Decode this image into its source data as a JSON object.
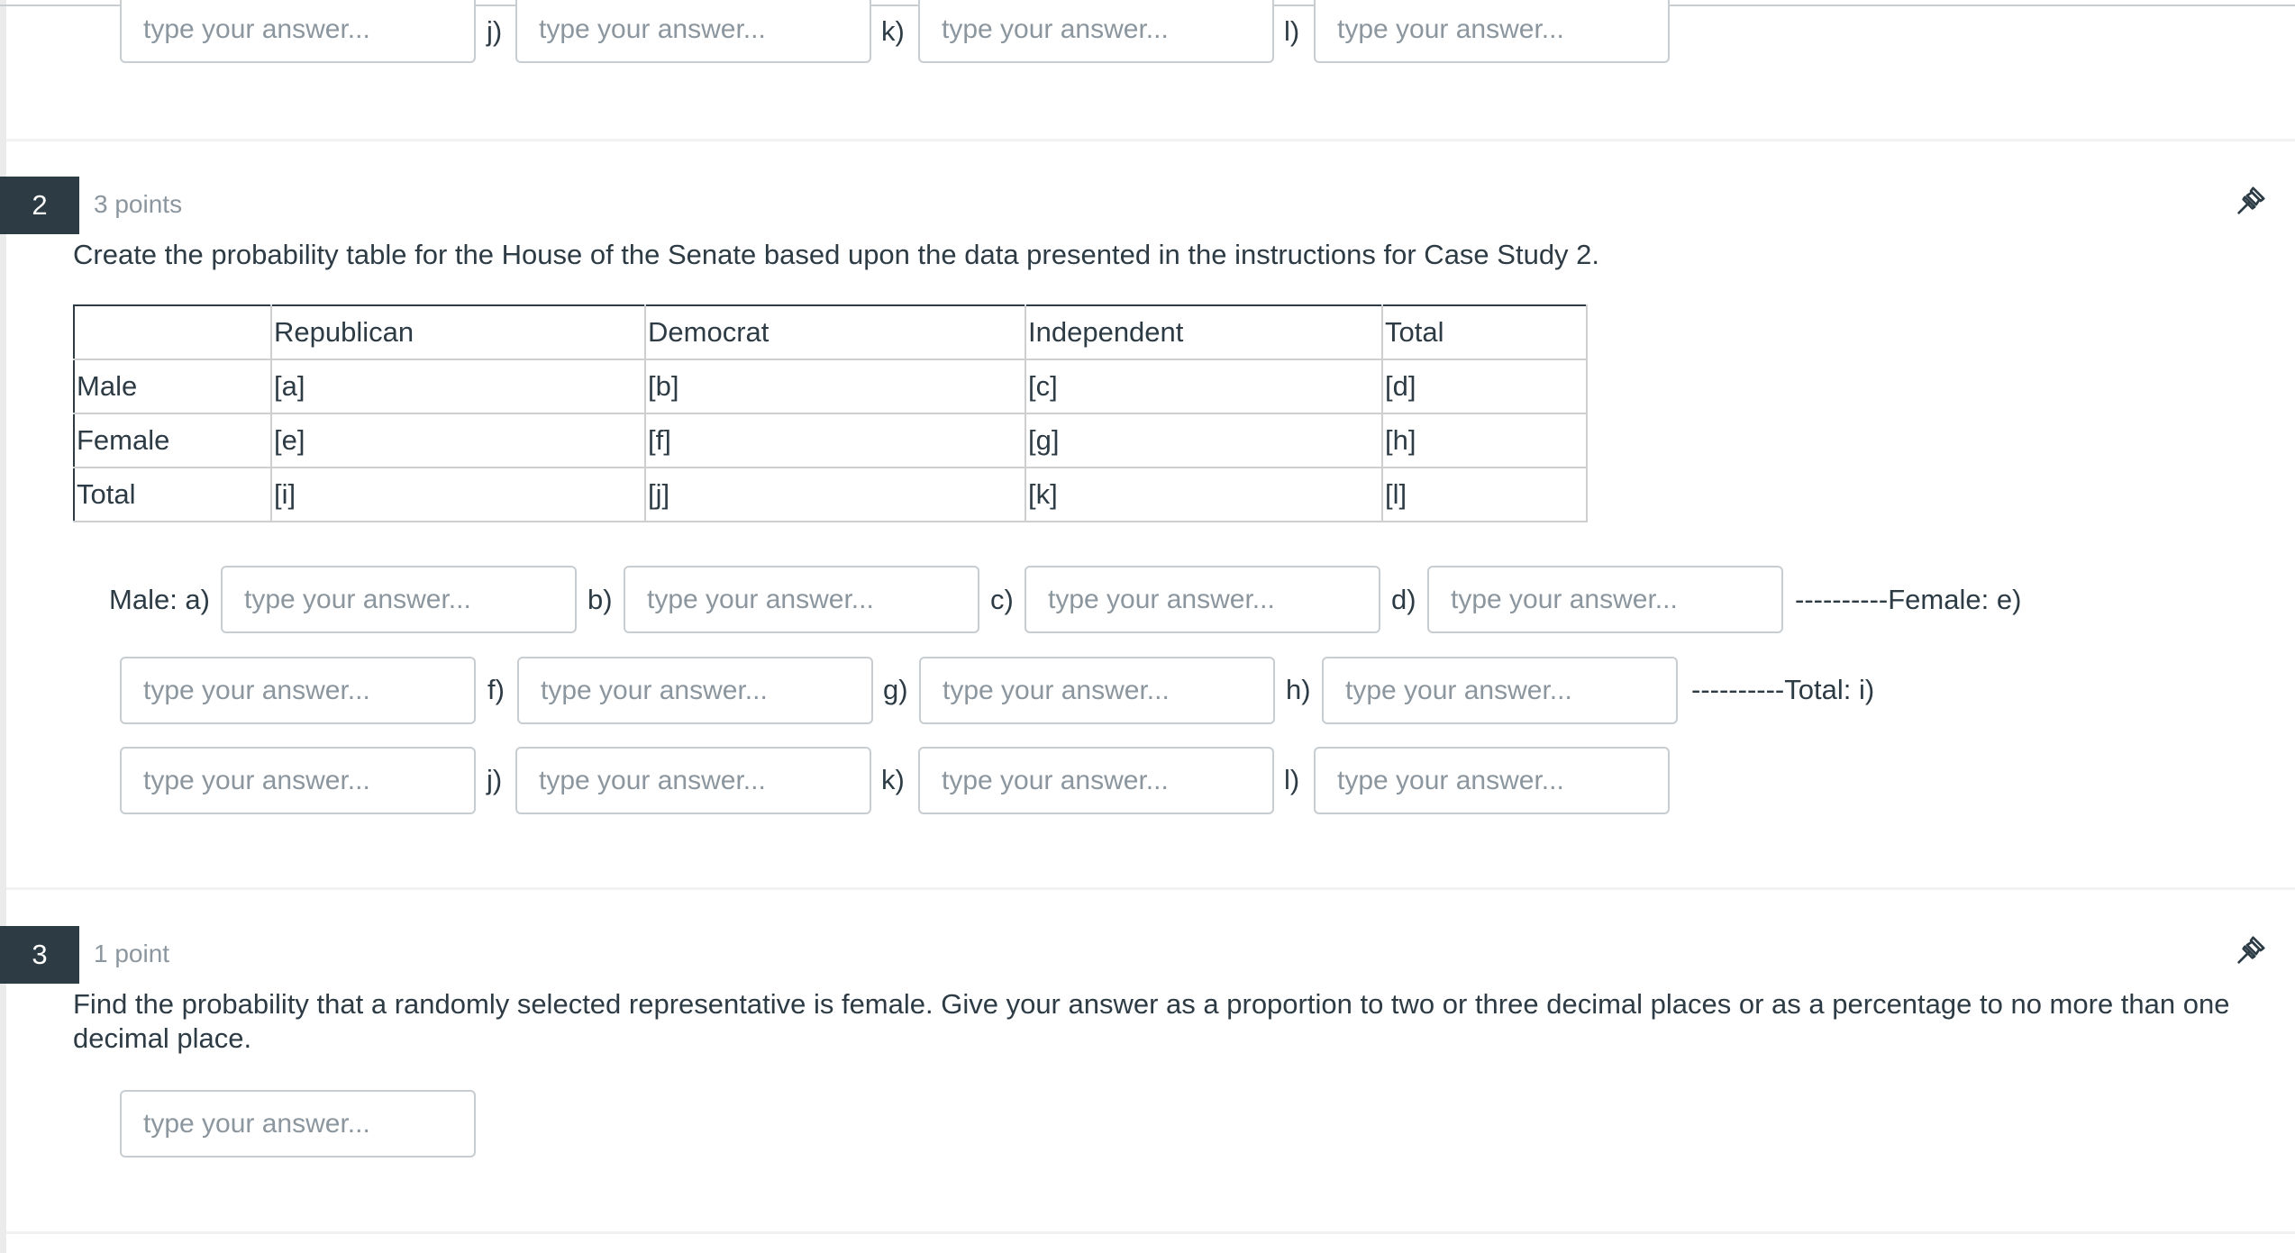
{
  "placeholder": "type your answer...",
  "previous_question_tail": {
    "labels": [
      "j)",
      "k)",
      "l)"
    ]
  },
  "question2": {
    "number": "2",
    "points": "3 points",
    "text": "Create the probability table for the House of the Senate based upon the data presented in the instructions for Case Study 2.",
    "table": {
      "headers": [
        "",
        "Republican",
        "Democrat",
        "Independent",
        "Total"
      ],
      "rows": [
        [
          "Male",
          "[a]",
          "[b]",
          "[c]",
          "[d]"
        ],
        [
          "Female",
          "[e]",
          "[f]",
          "[g]",
          "[h]"
        ],
        [
          "Total",
          "[i]",
          "[j]",
          "[k]",
          "[l]"
        ]
      ]
    },
    "blank_labels": {
      "a": "Male: a)",
      "b": "b)",
      "c": "c)",
      "d": "d)",
      "e": "----------Female: e)",
      "f": "f)",
      "g": "g)",
      "h": "h)",
      "i": "----------Total: i)",
      "j": "j)",
      "k": "k)",
      "l": "l)"
    }
  },
  "question3": {
    "number": "3",
    "points": "1 point",
    "text": "Find the probability that a randomly selected representative is female. Give your answer as a proportion to two or three decimal places or as a percentage to no more than one decimal place."
  },
  "icons": {
    "pin": "pin-icon"
  },
  "colors": {
    "badge_bg": "#2D3B45",
    "text": "#2D3B45",
    "muted": "#8B969E",
    "input_border": "#C7CDD1"
  }
}
